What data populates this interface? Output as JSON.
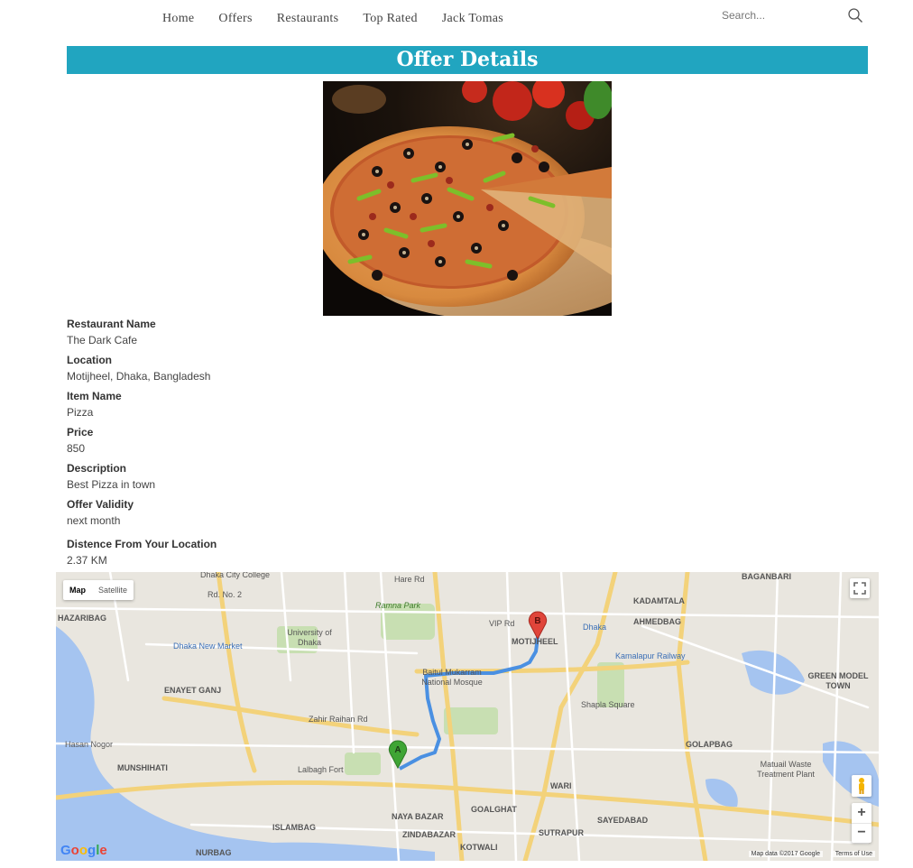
{
  "nav": {
    "links": [
      "Home",
      "Offers",
      "Restaurants",
      "Top Rated",
      "Jack Tomas"
    ],
    "search_placeholder": "Search..."
  },
  "banner": {
    "title": "Offer Details"
  },
  "details": [
    {
      "label": "Restaurant Name",
      "value": "The Dark Cafe"
    },
    {
      "label": "Location",
      "value": "Motijheel, Dhaka, Bangladesh"
    },
    {
      "label": "Item Name",
      "value": "Pizza"
    },
    {
      "label": "Price",
      "value": "850"
    },
    {
      "label": "Description",
      "value": "Best Pizza in town"
    },
    {
      "label": "Offer Validity",
      "value": "next month"
    },
    {
      "label": "Distence From Your Location",
      "value": "2.37 KM"
    }
  ],
  "map": {
    "type_controls": [
      "Map",
      "Satellite"
    ],
    "active_type": "Map",
    "marker_a": "A",
    "marker_b": "B",
    "zoom_in": "+",
    "zoom_out": "−",
    "attribution": "Map data ©2017 Google",
    "terms": "Terms of Use",
    "labels": [
      "Dhaka City College",
      "Hare Rd",
      "BAGANBARI",
      "Rd. No. 2",
      "Ramna Park",
      "KADAMTALA",
      "HAZARIBAG",
      "VIP Rd",
      "AHMEDBAG",
      "University of Dhaka",
      "Dhaka New Market",
      "MOTIJHEEL",
      "Kamalapur Railway",
      "Baitul Mukarram National Mosque",
      "ENAYET GANJ",
      "Shapla Square",
      "GREEN MODEL TOWN",
      "Zahir Raihan Rd",
      "Hasan Nogor",
      "GOLAPBAG",
      "MUNSHIHATI",
      "Lalbagh Fort",
      "Matuail Waste Treatment Plant",
      "WARI",
      "NAYA BAZAR",
      "GOALGHAT",
      "SAYEDABAD",
      "ISLAMBAG",
      "ZINDABAZAR",
      "SUTRAPUR",
      "KOTWALI",
      "NURBAG",
      "Dhaka"
    ]
  },
  "colors": {
    "banner": "#21a5c0",
    "route": "#4a90e2",
    "marker_a": "#3fa535",
    "marker_b": "#e0453a"
  }
}
